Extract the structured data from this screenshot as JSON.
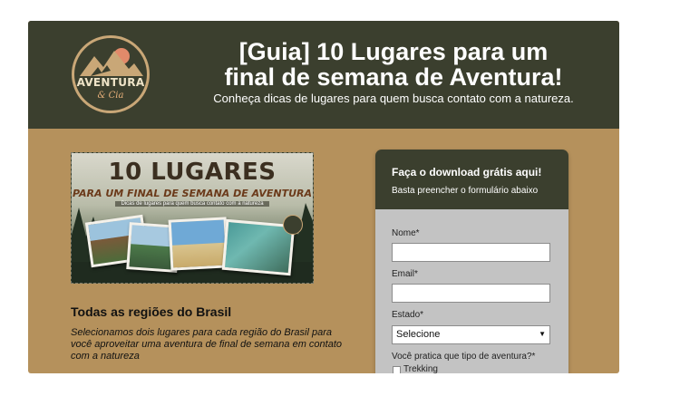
{
  "header": {
    "title_line1": "[Guia] 10 Lugares para um",
    "title_line2": "final de semana de Aventura!",
    "subtitle": "Conheça dicas de lugares para quem busca contato com a natureza."
  },
  "logo": {
    "line1": "AVENTURA",
    "line2": "& Cia"
  },
  "book": {
    "title": "10 LUGARES",
    "subtitle": "PARA UM FINAL DE SEMANA DE AVENTURA",
    "tagline": "Dicas de lugares para quem busca contato com a natureza"
  },
  "section": {
    "title": "Todas as regiões do Brasil",
    "text": "Selecionamos dois lugares para cada região do Brasil para você aproveitar uma aventura de final de semana em contato com a natureza"
  },
  "form": {
    "heading": "Faça o download grátis aqui!",
    "subheading": "Basta preencher o formulário abaixo",
    "name_label": "Nome*",
    "email_label": "Email*",
    "state_label": "Estado*",
    "state_value": "Selecione",
    "adventure_label": "Você pratica que tipo de aventura?*",
    "options": [
      "Trekking"
    ]
  },
  "colors": {
    "header_bg": "#3b3f2e",
    "page_bg": "#b5915c",
    "form_body": "#c3c3c3"
  }
}
